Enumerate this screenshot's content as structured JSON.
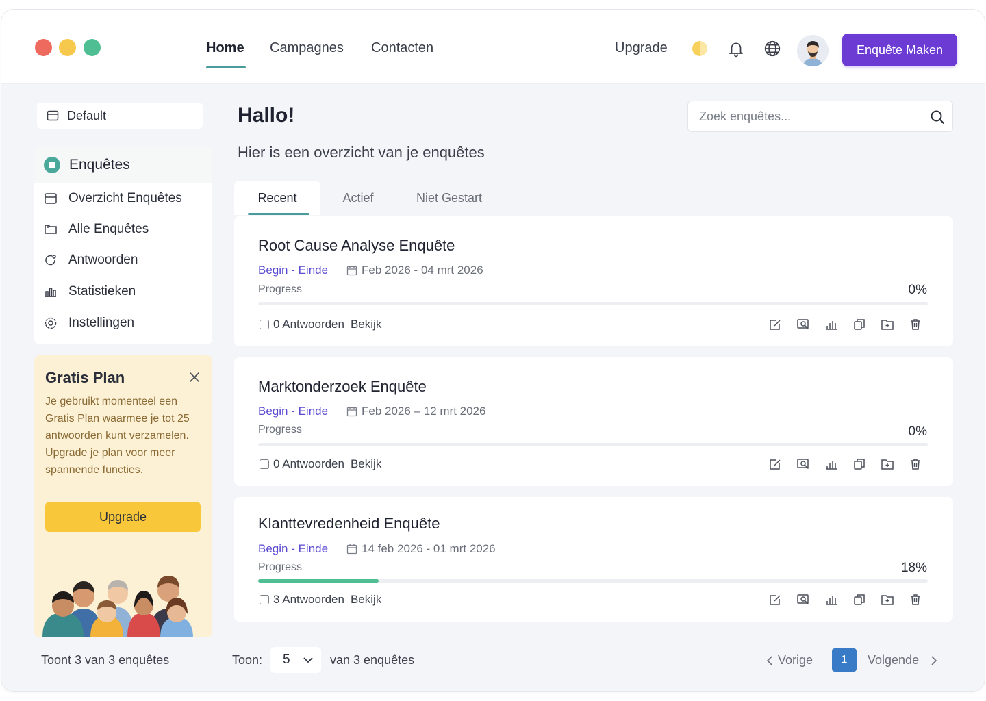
{
  "nav": {
    "home": "Home",
    "campaigns": "Campagnes",
    "contacts": "Contacten",
    "upgrade": "Upgrade",
    "create_button": "Enquête Maken"
  },
  "sidebar": {
    "workspace": "Default",
    "section_title": "Enquêtes",
    "items": [
      {
        "label": "Overzicht Enquêtes",
        "icon": "overview-icon"
      },
      {
        "label": "Alle Enquêtes",
        "icon": "folder-icon"
      },
      {
        "label": "Antwoorden",
        "icon": "responses-icon"
      },
      {
        "label": "Statistieken",
        "icon": "stats-icon"
      },
      {
        "label": "Instellingen",
        "icon": "settings-icon"
      }
    ],
    "footer": "Toont 3 van 3 enquêtes"
  },
  "plan": {
    "title": "Gratis Plan",
    "text": "Je gebruikt momenteel een Gratis Plan waarmee je tot 25 antwoorden kunt verzamelen. Upgrade je plan voor meer spannende functies.",
    "button": "Upgrade"
  },
  "main": {
    "greeting": "Hallo!",
    "subtitle": "Hier is een overzicht van je enquêtes",
    "search_placeholder": "Zoek enquêtes...",
    "tabs": [
      "Recent",
      "Actief",
      "Niet Gestart"
    ],
    "progress_label": "Progress",
    "dates_label": "Begin - Einde",
    "view_label": "Bekijk"
  },
  "surveys": [
    {
      "title": "Root Cause Analyse Enquête",
      "dates": "Feb 2026 - 04 mrt 2026",
      "progress": 0,
      "progress_text": "0%",
      "responses": "0 Antwoorden"
    },
    {
      "title": "Marktonderzoek Enquête",
      "dates": "Feb 2026 – 12 mrt 2026",
      "progress": 0,
      "progress_text": "0%",
      "responses": "0 Antwoorden"
    },
    {
      "title": "Klanttevredenheid Enquête",
      "dates": "14 feb 2026 - 01 mrt 2026",
      "progress": 18,
      "progress_text": "18%",
      "responses": "3 Antwoorden"
    }
  ],
  "pager": {
    "show_label": "Toon:",
    "page_size": "5",
    "of_label": "van 3 enquêtes",
    "prev": "Vorige",
    "page": "1",
    "next": "Volgende"
  },
  "colors": {
    "accent": "#6c3bd4",
    "teal": "#4a9b9b",
    "progress": "#4fbf93",
    "plan_bg": "#fdf1d5",
    "plan_button": "#f8c83a",
    "page_active": "#3a7bc8"
  }
}
